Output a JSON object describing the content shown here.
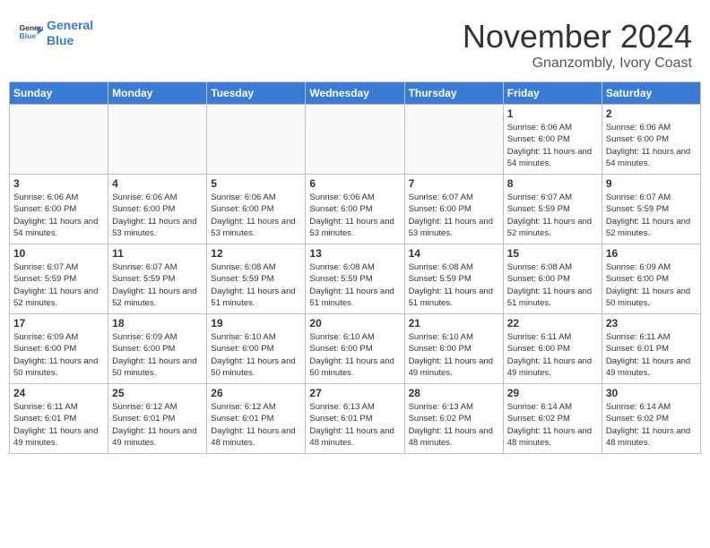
{
  "header": {
    "logo_line1": "General",
    "logo_line2": "Blue",
    "month": "November 2024",
    "location": "Gnanzombly, Ivory Coast"
  },
  "weekdays": [
    "Sunday",
    "Monday",
    "Tuesday",
    "Wednesday",
    "Thursday",
    "Friday",
    "Saturday"
  ],
  "weeks": [
    [
      {
        "day": "",
        "info": ""
      },
      {
        "day": "",
        "info": ""
      },
      {
        "day": "",
        "info": ""
      },
      {
        "day": "",
        "info": ""
      },
      {
        "day": "",
        "info": ""
      },
      {
        "day": "1",
        "info": "Sunrise: 6:06 AM\nSunset: 6:00 PM\nDaylight: 11 hours\nand 54 minutes."
      },
      {
        "day": "2",
        "info": "Sunrise: 6:06 AM\nSunset: 6:00 PM\nDaylight: 11 hours\nand 54 minutes."
      }
    ],
    [
      {
        "day": "3",
        "info": "Sunrise: 6:06 AM\nSunset: 6:00 PM\nDaylight: 11 hours\nand 54 minutes."
      },
      {
        "day": "4",
        "info": "Sunrise: 6:06 AM\nSunset: 6:00 PM\nDaylight: 11 hours\nand 53 minutes."
      },
      {
        "day": "5",
        "info": "Sunrise: 6:06 AM\nSunset: 6:00 PM\nDaylight: 11 hours\nand 53 minutes."
      },
      {
        "day": "6",
        "info": "Sunrise: 6:06 AM\nSunset: 6:00 PM\nDaylight: 11 hours\nand 53 minutes."
      },
      {
        "day": "7",
        "info": "Sunrise: 6:07 AM\nSunset: 6:00 PM\nDaylight: 11 hours\nand 53 minutes."
      },
      {
        "day": "8",
        "info": "Sunrise: 6:07 AM\nSunset: 5:59 PM\nDaylight: 11 hours\nand 52 minutes."
      },
      {
        "day": "9",
        "info": "Sunrise: 6:07 AM\nSunset: 5:59 PM\nDaylight: 11 hours\nand 52 minutes."
      }
    ],
    [
      {
        "day": "10",
        "info": "Sunrise: 6:07 AM\nSunset: 5:59 PM\nDaylight: 11 hours\nand 52 minutes."
      },
      {
        "day": "11",
        "info": "Sunrise: 6:07 AM\nSunset: 5:59 PM\nDaylight: 11 hours\nand 52 minutes."
      },
      {
        "day": "12",
        "info": "Sunrise: 6:08 AM\nSunset: 5:59 PM\nDaylight: 11 hours\nand 51 minutes."
      },
      {
        "day": "13",
        "info": "Sunrise: 6:08 AM\nSunset: 5:59 PM\nDaylight: 11 hours\nand 51 minutes."
      },
      {
        "day": "14",
        "info": "Sunrise: 6:08 AM\nSunset: 5:59 PM\nDaylight: 11 hours\nand 51 minutes."
      },
      {
        "day": "15",
        "info": "Sunrise: 6:08 AM\nSunset: 6:00 PM\nDaylight: 11 hours\nand 51 minutes."
      },
      {
        "day": "16",
        "info": "Sunrise: 6:09 AM\nSunset: 6:00 PM\nDaylight: 11 hours\nand 50 minutes."
      }
    ],
    [
      {
        "day": "17",
        "info": "Sunrise: 6:09 AM\nSunset: 6:00 PM\nDaylight: 11 hours\nand 50 minutes."
      },
      {
        "day": "18",
        "info": "Sunrise: 6:09 AM\nSunset: 6:00 PM\nDaylight: 11 hours\nand 50 minutes."
      },
      {
        "day": "19",
        "info": "Sunrise: 6:10 AM\nSunset: 6:00 PM\nDaylight: 11 hours\nand 50 minutes."
      },
      {
        "day": "20",
        "info": "Sunrise: 6:10 AM\nSunset: 6:00 PM\nDaylight: 11 hours\nand 50 minutes."
      },
      {
        "day": "21",
        "info": "Sunrise: 6:10 AM\nSunset: 6:00 PM\nDaylight: 11 hours\nand 49 minutes."
      },
      {
        "day": "22",
        "info": "Sunrise: 6:11 AM\nSunset: 6:00 PM\nDaylight: 11 hours\nand 49 minutes."
      },
      {
        "day": "23",
        "info": "Sunrise: 6:11 AM\nSunset: 6:01 PM\nDaylight: 11 hours\nand 49 minutes."
      }
    ],
    [
      {
        "day": "24",
        "info": "Sunrise: 6:11 AM\nSunset: 6:01 PM\nDaylight: 11 hours\nand 49 minutes."
      },
      {
        "day": "25",
        "info": "Sunrise: 6:12 AM\nSunset: 6:01 PM\nDaylight: 11 hours\nand 49 minutes."
      },
      {
        "day": "26",
        "info": "Sunrise: 6:12 AM\nSunset: 6:01 PM\nDaylight: 11 hours\nand 48 minutes."
      },
      {
        "day": "27",
        "info": "Sunrise: 6:13 AM\nSunset: 6:01 PM\nDaylight: 11 hours\nand 48 minutes."
      },
      {
        "day": "28",
        "info": "Sunrise: 6:13 AM\nSunset: 6:02 PM\nDaylight: 11 hours\nand 48 minutes."
      },
      {
        "day": "29",
        "info": "Sunrise: 6:14 AM\nSunset: 6:02 PM\nDaylight: 11 hours\nand 48 minutes."
      },
      {
        "day": "30",
        "info": "Sunrise: 6:14 AM\nSunset: 6:02 PM\nDaylight: 11 hours\nand 48 minutes."
      }
    ]
  ]
}
